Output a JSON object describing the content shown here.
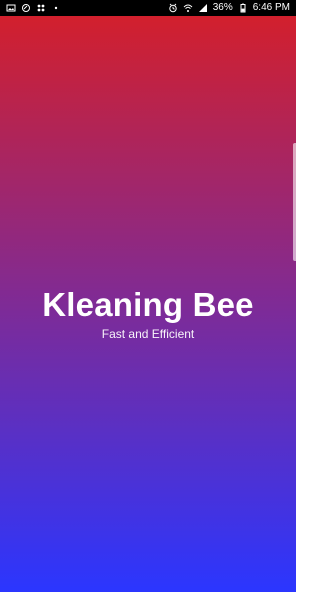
{
  "status_bar": {
    "left_icons": [
      "gallery-icon",
      "screen-record-icon",
      "app-grid-icon",
      "dots-icon"
    ],
    "right_icons": [
      "alarm-icon",
      "wifi-icon",
      "signal-icon"
    ],
    "battery_percent": "36%",
    "time": "6:46 PM"
  },
  "splash": {
    "title": "Kleaning Bee",
    "subtitle": "Fast and Efficient"
  },
  "colors": {
    "gradient_top": "#d71f27",
    "gradient_bottom": "#2b36ff",
    "text": "#ffffff",
    "status_bar": "#000000"
  }
}
